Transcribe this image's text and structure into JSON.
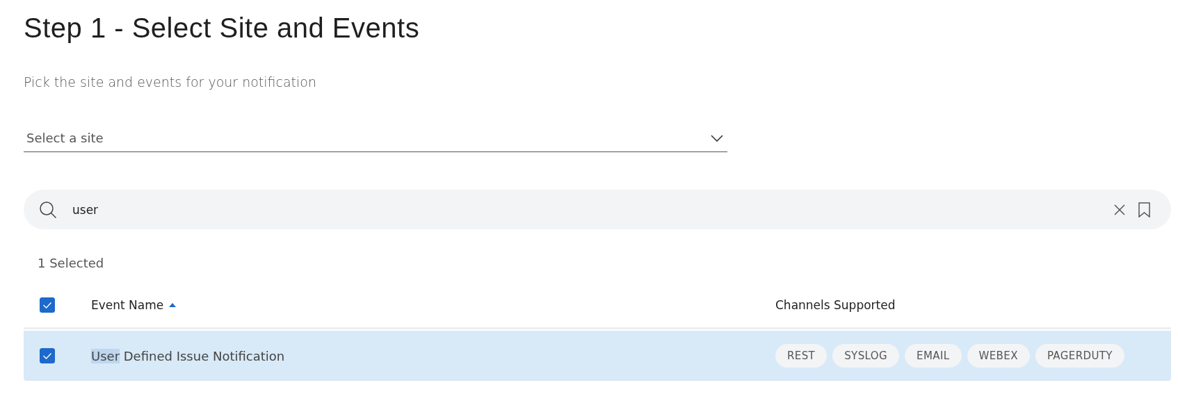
{
  "title": "Step 1 - Select Site and Events",
  "subtitle": "Pick the site and events for your notification",
  "site_select": {
    "placeholder": "Select a site"
  },
  "search": {
    "value": "user"
  },
  "selection_count": "1 Selected",
  "table": {
    "select_all_checked": true,
    "columns": [
      {
        "label": "Event Name",
        "sorted": true
      },
      {
        "label": "Channels Supported",
        "sorted": false
      }
    ],
    "rows": [
      {
        "selected": true,
        "name_parts": [
          {
            "text": "User",
            "highlighted": true
          },
          {
            "text": " Defined Issue Notification",
            "highlighted": false
          }
        ],
        "channels": [
          "REST",
          "SYSLOG",
          "EMAIL",
          "WEBEX",
          "PAGERDUTY"
        ]
      }
    ]
  }
}
